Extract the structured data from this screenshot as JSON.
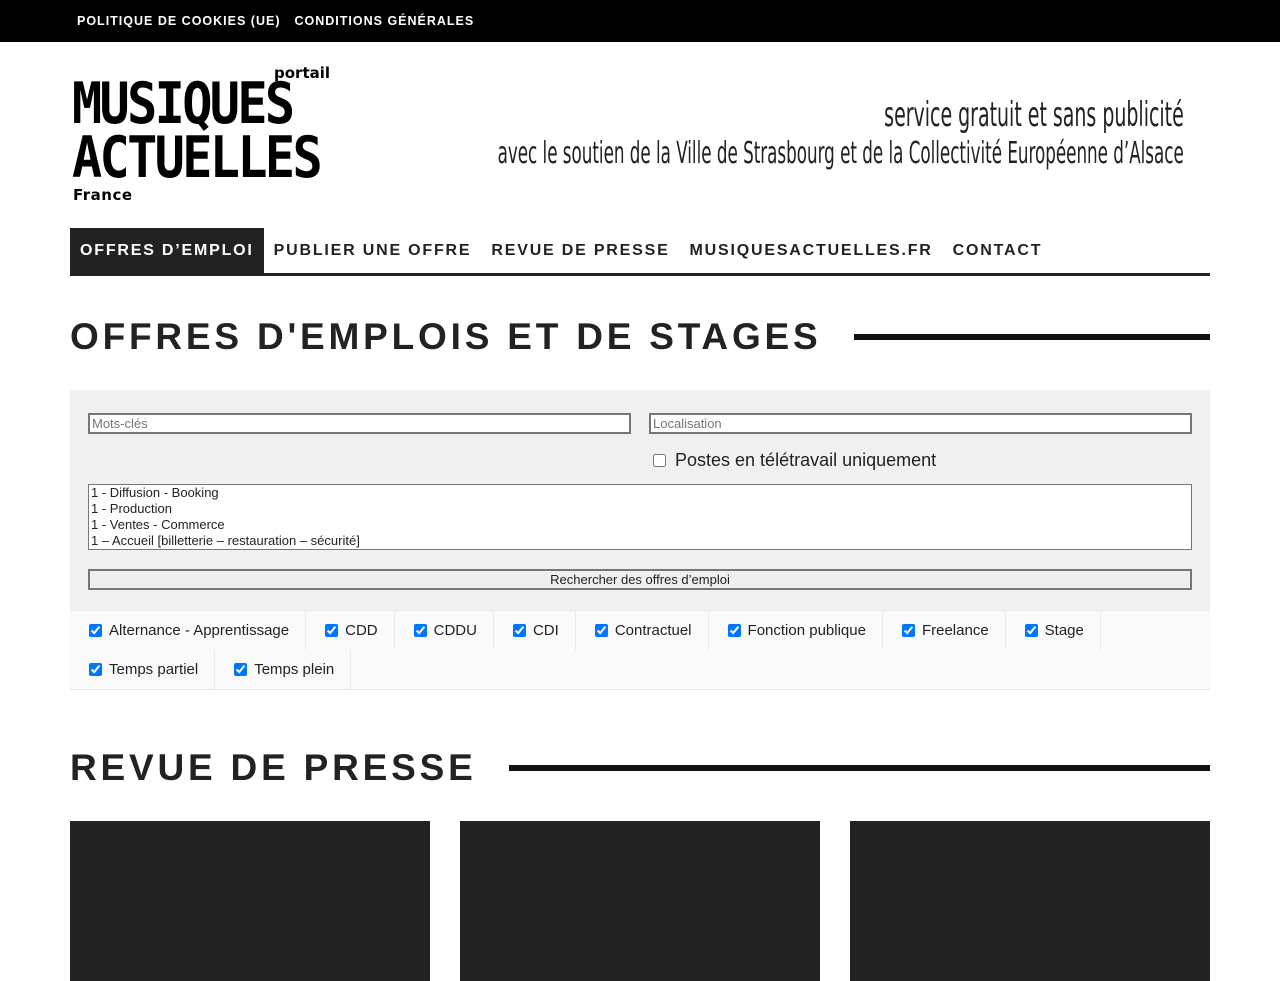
{
  "topbar": {
    "links": [
      "Politique de cookies (UE)",
      "Conditions générales"
    ]
  },
  "logo": {
    "portail": "portail",
    "line1": "MUSIQUES",
    "line2": "ACTUELLES",
    "france": "France"
  },
  "tagline": {
    "line1": "service gratuit et sans publicité",
    "line2": "avec le soutien de la Ville de Strasbourg et de la Collectivité Européenne d’Alsace"
  },
  "nav": {
    "items": [
      "Offres d’emploi",
      "Publier une offre",
      "Revue de presse",
      "musiquesactuelles.fr",
      "Contact"
    ],
    "active_index": 0
  },
  "jobs_section": {
    "title": "Offres d'emplois et de stages"
  },
  "search": {
    "keywords_placeholder": "Mots-clés",
    "location_placeholder": "Localisation",
    "remote_label": "Postes en télétravail uniquement",
    "remote_checked": false,
    "categories": [
      "1 - Diffusion - Booking",
      "1 - Production",
      "1 - Ventes - Commerce",
      "1 – Accueil [billetterie – restauration – sécurité]"
    ],
    "submit_label": "Rechercher des offres d’emploi"
  },
  "job_types": [
    {
      "label": "Alternance - Apprentissage",
      "checked": true
    },
    {
      "label": "CDD",
      "checked": true
    },
    {
      "label": "CDDU",
      "checked": true
    },
    {
      "label": "CDI",
      "checked": true
    },
    {
      "label": "Contractuel",
      "checked": true
    },
    {
      "label": "Fonction publique",
      "checked": true
    },
    {
      "label": "Freelance",
      "checked": true
    },
    {
      "label": "Stage",
      "checked": true
    },
    {
      "label": "Temps partiel",
      "checked": true
    },
    {
      "label": "Temps plein",
      "checked": true
    }
  ],
  "press_section": {
    "title": "Revue de presse"
  },
  "colors": {
    "dark": "#222222",
    "black": "#000000",
    "search_bg": "#f0f0f0",
    "checkbox_accent": "#0075ff"
  }
}
